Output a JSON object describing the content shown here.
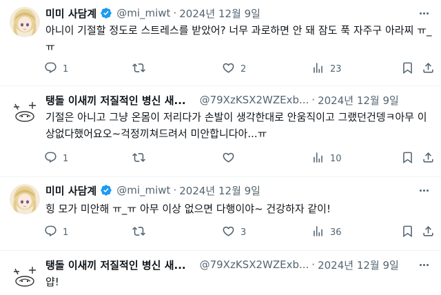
{
  "tweets": [
    {
      "name": "미미 사담계",
      "handle": "@mi_miwt",
      "date": "2024년 12월 9일",
      "verified": true,
      "text": "아니이 기절할 정도로 스트레스를 받았어? 너무 과로하면 안 돼 잠도 푹 자주구 아라찌 ㅠ_ㅠ",
      "replies": "1",
      "retweets": "",
      "likes": "2",
      "views": "23"
    },
    {
      "name": "탱돌 이새끼 저질적인 병신 새...",
      "handle": "@79XzKSX2WZExb...",
      "date": "2024년 12월 9일",
      "verified": false,
      "text": "기절은 아니고 그냥 온몸이 저리다가 손발이 생각한대로 안움직이고 그랬던건뎅ㅋ아무 이상없다했어요오~걱정끼쳐드려서 미안합니다아...ㅠ",
      "replies": "1",
      "retweets": "",
      "likes": "",
      "views": "10"
    },
    {
      "name": "미미 사담계",
      "handle": "@mi_miwt",
      "date": "2024년 12월 9일",
      "verified": true,
      "text": "힝 모가 미안해 ㅠ_ㅠ 아무 이상 없으면 다행이야~ 건강하자 같이!",
      "replies": "1",
      "retweets": "",
      "likes": "3",
      "views": "36"
    },
    {
      "name": "탱돌 이새끼 저질적인 병신 새...",
      "handle": "@79XzKSX2WZExb...",
      "date": "2024년 12월 9일",
      "verified": false,
      "text": "얍!"
    }
  ],
  "icons": {
    "reply": "speech-bubble-icon",
    "retweet": "retweet-arrows-icon",
    "like": "heart-icon",
    "views": "bar-chart-icon",
    "bookmark": "bookmark-icon",
    "share": "share-upload-icon",
    "more": "more-dots-icon",
    "verified": "verified-badge-icon"
  },
  "colors": {
    "verified_badge": "#1d9bf0",
    "secondary_text": "#536471",
    "divider": "#eff3f4"
  }
}
